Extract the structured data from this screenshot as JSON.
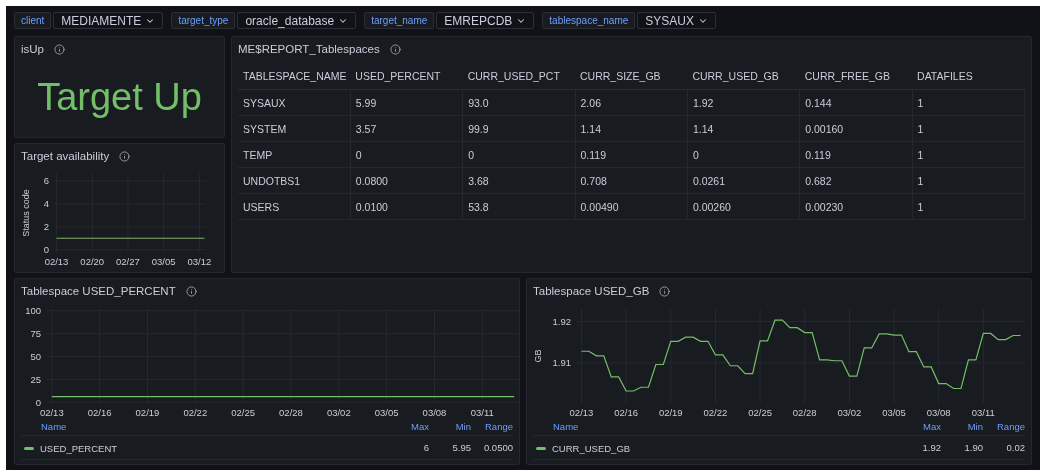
{
  "variables": [
    {
      "label": "client",
      "value": "MEDIAMENTE"
    },
    {
      "label": "target_type",
      "value": "oracle_database"
    },
    {
      "label": "target_name",
      "value": "EMREPCDB"
    },
    {
      "label": "tablespace_name",
      "value": "SYSAUX"
    }
  ],
  "is_up": {
    "title": "isUp",
    "value": "Target Up"
  },
  "availability": {
    "title": "Target availability",
    "chart_data": {
      "type": "line",
      "ylabel": "Status code",
      "grid": true,
      "categories": [
        "02/13",
        null,
        null,
        null,
        null,
        null,
        null,
        "02/20",
        null,
        null,
        null,
        null,
        null,
        null,
        "02/27",
        null,
        null,
        null,
        null,
        null,
        null,
        "03/05",
        null,
        null,
        null,
        null,
        null,
        null,
        "03/12",
        null
      ],
      "series": [
        {
          "color": "#7eb26d",
          "values": [
            1,
            1,
            1,
            1,
            1,
            1,
            1,
            1,
            1,
            1,
            1,
            1,
            1,
            1,
            1,
            1,
            1,
            1,
            1,
            1,
            1,
            1,
            1,
            1,
            1,
            1,
            1,
            1,
            1,
            1
          ]
        }
      ],
      "ylim": [
        -0.2,
        6.6
      ],
      "yticks": [
        0,
        2,
        4,
        6
      ]
    }
  },
  "table": {
    "title": "ME$REPORT_Tablespaces",
    "columns": [
      "TABLESPACE_NAME",
      "USED_PERCENT",
      "CURR_USED_PCT",
      "CURR_SIZE_GB",
      "CURR_USED_GB",
      "CURR_FREE_GB",
      "DATAFILES"
    ],
    "rows": [
      [
        "SYSAUX",
        "5.99",
        "93.0",
        "2.06",
        "1.92",
        "0.144",
        "1"
      ],
      [
        "SYSTEM",
        "3.57",
        "99.9",
        "1.14",
        "1.14",
        "0.00160",
        "1"
      ],
      [
        "TEMP",
        "0",
        "0",
        "0.119",
        "0",
        "0.119",
        "1"
      ],
      [
        "UNDOTBS1",
        "0.0800",
        "3.68",
        "0.708",
        "0.0261",
        "0.682",
        "1"
      ],
      [
        "USERS",
        "0.0100",
        "53.8",
        "0.00490",
        "0.00260",
        "0.00230",
        "1"
      ]
    ]
  },
  "used_percent": {
    "title": "Tablespace USED_PERCENT",
    "chart_data": {
      "type": "line",
      "grid": true,
      "categories": [
        "02/13",
        null,
        null,
        "02/16",
        null,
        null,
        "02/19",
        null,
        null,
        "02/22",
        null,
        null,
        "02/25",
        null,
        null,
        "02/28",
        null,
        null,
        "03/02",
        null,
        null,
        "03/05",
        null,
        null,
        "03/08",
        null,
        null,
        "03/11",
        null,
        null
      ],
      "series": [
        {
          "color": "#73bf69",
          "values": [
            6,
            6,
            6,
            6,
            6,
            6,
            6,
            6,
            6,
            6,
            6,
            6,
            6,
            6,
            6,
            6,
            6,
            6,
            6,
            6,
            6,
            6,
            6,
            6,
            6,
            6,
            6,
            6,
            6,
            6
          ]
        }
      ],
      "ylim": [
        -1,
        102
      ],
      "yticks": [
        0,
        25,
        50,
        75,
        100
      ]
    },
    "legend": {
      "columns": [
        "Name",
        "Max",
        "Min",
        "Range"
      ],
      "rows": [
        {
          "name": "USED_PERCENT",
          "color": "#73bf69",
          "max": "6",
          "min": "5.95",
          "range": "0.0500"
        }
      ]
    }
  },
  "used_gb": {
    "title": "Tablespace USED_GB",
    "chart_data": {
      "type": "line",
      "ylabel": "GB",
      "grid": true,
      "categories": [
        "02/13",
        null,
        null,
        null,
        null,
        null,
        "02/16",
        null,
        null,
        null,
        null,
        null,
        "02/19",
        null,
        null,
        null,
        null,
        null,
        "02/22",
        null,
        null,
        null,
        null,
        null,
        "02/25",
        null,
        null,
        null,
        null,
        null,
        "02/28",
        null,
        null,
        null,
        null,
        null,
        "03/02",
        null,
        null,
        null,
        null,
        null,
        "03/05",
        null,
        null,
        null,
        null,
        null,
        "03/08",
        null,
        null,
        null,
        null,
        null,
        "03/11",
        null,
        null,
        null,
        null,
        null
      ],
      "series": [
        {
          "color": "#73bf69",
          "values": [
            1.9128,
            1.9128,
            1.9117,
            1.9117,
            1.9066,
            1.9066,
            1.9032,
            1.9032,
            1.9041,
            1.9041,
            1.9096,
            1.9096,
            1.9152,
            1.9152,
            1.9162,
            1.9162,
            1.9152,
            1.9152,
            1.9119,
            1.9119,
            1.9093,
            1.9093,
            1.9074,
            1.9074,
            1.9153,
            1.9153,
            1.9203,
            1.9203,
            1.9185,
            1.9185,
            1.9173,
            1.9173,
            1.9107,
            1.9107,
            1.9105,
            1.9105,
            1.9068,
            1.9068,
            1.9136,
            1.9136,
            1.917,
            1.917,
            1.9167,
            1.9167,
            1.9127,
            1.9127,
            1.909,
            1.909,
            1.905,
            1.905,
            1.9038,
            1.9038,
            1.9107,
            1.9107,
            1.9171,
            1.9171,
            1.9156,
            1.9156,
            1.9166,
            1.9166
          ]
        }
      ],
      "ylim": [
        1.9003,
        1.923
      ],
      "yticks": [
        1.91,
        1.92
      ]
    },
    "legend": {
      "columns": [
        "Name",
        "Max",
        "Min",
        "Range"
      ],
      "rows": [
        {
          "name": "CURR_USED_GB",
          "color": "#73bf69",
          "max": "1.92",
          "min": "1.90",
          "range": "0.02"
        }
      ]
    }
  }
}
